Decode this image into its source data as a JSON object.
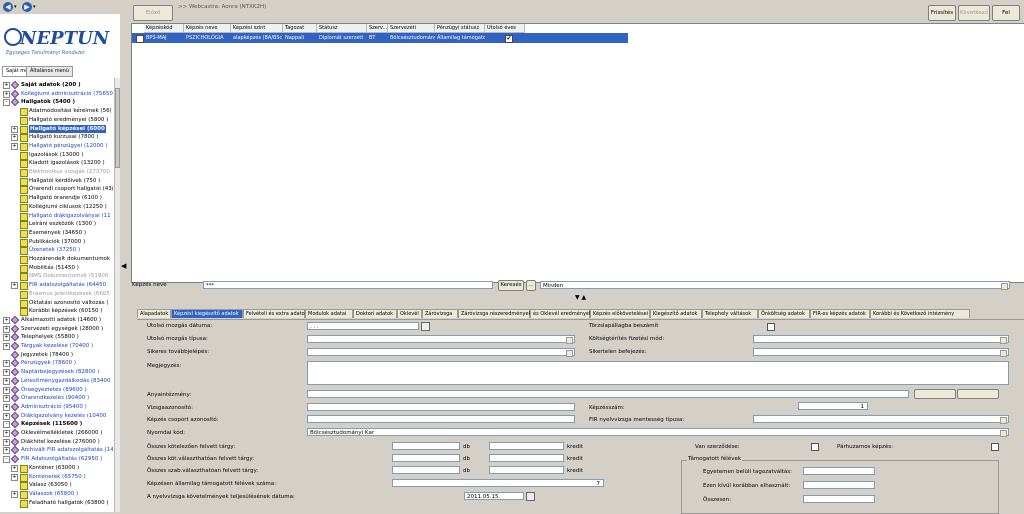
{
  "app": {
    "brand": "NEPTUN",
    "subtitle": "Egységes Tanulmányi Rendszer"
  },
  "left_tabs": [
    "Saját menü",
    "Általános menü"
  ],
  "tree": [
    {
      "label": "Saját adatok (200 )",
      "level": 0,
      "bold": true,
      "exp": "+"
    },
    {
      "label": "Kollégiumi adminisztráció (75650",
      "level": 0,
      "blue": true,
      "exp": "+"
    },
    {
      "label": "Hallgatók (5400 )",
      "level": 0,
      "bold": true,
      "exp": "-"
    },
    {
      "label": "Adatmódosítási kérelmek (56(",
      "level": 1
    },
    {
      "label": "Hallgató eredményei (5800 )",
      "level": 1
    },
    {
      "label": "Hallgató képzései (6000",
      "level": 1,
      "selected": true,
      "exp": "+"
    },
    {
      "label": "Hallgató kurzusai (7800 )",
      "level": 1,
      "exp": "+"
    },
    {
      "label": "Hallgató pénzügyei (12000 )",
      "level": 1,
      "blue": true,
      "exp": "+"
    },
    {
      "label": "Igazolások (13000 )",
      "level": 1
    },
    {
      "label": "Kiadott igazolások (13200 )",
      "level": 1
    },
    {
      "label": "Elektronikus vizsgák (273700",
      "level": 1,
      "gray": true
    },
    {
      "label": "Hallgatói kérdőívek (750 )",
      "level": 1
    },
    {
      "label": "Órarendi csoport hallgatói (43(",
      "level": 1
    },
    {
      "label": "Hallgató órarendje (6100 )",
      "level": 1
    },
    {
      "label": "Kollégiumi ciklusok (12250 )",
      "level": 1
    },
    {
      "label": "Hallgató diákigazolványai (11",
      "level": 1,
      "blue": true
    },
    {
      "label": "Leíráni eszközök (1300 )",
      "level": 1
    },
    {
      "label": "Események (34650 )",
      "level": 1
    },
    {
      "label": "Publikációk (37000 )",
      "level": 1
    },
    {
      "label": "Üzenetek (37250 )",
      "level": 1,
      "blue": true
    },
    {
      "label": "Hozzárendelt dokumentumok",
      "level": 1
    },
    {
      "label": "Mobilitás (51450 )",
      "level": 1
    },
    {
      "label": "NMS Dokumentumok (51900",
      "level": 1,
      "gray": true
    },
    {
      "label": "FIR adatszolgáltatás (64450",
      "level": 1,
      "blue": true,
      "exp": "+"
    },
    {
      "label": "Érasmus jelentkezések (6605",
      "level": 1,
      "gray": true
    },
    {
      "label": "Oktatási azonosító változás (",
      "level": 1
    },
    {
      "label": "Korábbi képzések (60150 )",
      "level": 1
    },
    {
      "label": "Alkalmazotti adatok (14600 )",
      "level": 0,
      "exp": "+"
    },
    {
      "label": "Szervezeti egységek (28000 )",
      "level": 0,
      "exp": "+"
    },
    {
      "label": "Telephelyek (55800 )",
      "level": 0,
      "exp": "+"
    },
    {
      "label": "Tárgyak kezelése (70400 )",
      "level": 0,
      "blue": true,
      "exp": "+"
    },
    {
      "label": "Jegyzetek (78400 )",
      "level": 0
    },
    {
      "label": "Pénzügyek (78600 )",
      "level": 0,
      "blue": true,
      "exp": "+"
    },
    {
      "label": "Naptárbejegyzések (82800 )",
      "level": 0,
      "blue": true,
      "exp": "+"
    },
    {
      "label": "Létesítménygazdálkodás (83400",
      "level": 0,
      "blue": true,
      "exp": "+"
    },
    {
      "label": "Óraegyeztetés (89600 )",
      "level": 0,
      "blue": true,
      "exp": "+"
    },
    {
      "label": "Órarendkezelés (90400 )",
      "level": 0,
      "blue": true,
      "exp": "+"
    },
    {
      "label": "Adminisztráció (95400 )",
      "level": 0,
      "blue": true,
      "exp": "+"
    },
    {
      "label": "Diákigazolvány kezelés (10400",
      "level": 0,
      "blue": true,
      "exp": "+"
    },
    {
      "label": "Képzések (115600 )",
      "level": 0,
      "bold": true,
      "exp": "-"
    },
    {
      "label": "Oklevélmellékletek (266000 )",
      "level": 0,
      "exp": "+"
    },
    {
      "label": "Diákhitel kezelése (276000 )",
      "level": 0,
      "exp": "+"
    },
    {
      "label": "Archivált FIR adatszolgáltatás (14",
      "level": 0,
      "blue": true,
      "exp": "+"
    },
    {
      "label": "FIR Adatszolgáltatás (62950 )",
      "level": 0,
      "blue": true,
      "exp": "-"
    },
    {
      "label": "Konténer (63000 )",
      "level": 1,
      "exp": "+"
    },
    {
      "label": "Konténerek (65750 )",
      "level": 1,
      "blue": true,
      "exp": "+"
    },
    {
      "label": "Válasz (63050 )",
      "level": 1
    },
    {
      "label": "Válaszok (65800 )",
      "level": 1,
      "blue": true,
      "exp": "+"
    },
    {
      "label": "Feladható hallgatók (63800 )",
      "level": 1
    }
  ],
  "toolbar": {
    "back": "Előző",
    "breadcrumb": ">> Webcastra: Aonra (NTXK2H)",
    "refresh": "Frissítés",
    "next": "Következő",
    "up": "Fel"
  },
  "grid": {
    "columns": [
      "Képzéskód",
      "Képzés neve",
      "Képzési szint",
      "Tagozat",
      "Státusz",
      "Szerv...",
      "Szervezeti egysé...",
      "Pénzügyi státusz",
      "Utolsó éves"
    ],
    "rows": [
      [
        "BPS-MAJ",
        "PSZICHOLÓGIA",
        "alapképzés (BA/BSc)",
        "Nappali",
        "Diplomát szerzett",
        "BT",
        "Bölcsésztudományi ...",
        "Államilag támogatott",
        "✔"
      ]
    ]
  },
  "search": {
    "label": "Képzés neve",
    "value": "***",
    "button": "Keresés",
    "filter": "Minden"
  },
  "tabs": [
    "Alapadatok",
    "Képzési kiegészítő adatok",
    "Felvételi és extra adatok",
    "Modulok adatai",
    "Doktori adatok",
    "Oklevél",
    "Záróvizsga",
    "Záróvizsga részeredmények",
    "és Oklevél eredmények",
    "Képzés előkövetelései",
    "Kiegészítő adatok",
    "Telephely váltások",
    "Önköltség adatok",
    "FIR-es képzés adatok",
    "Korábbi és Következő intézmény"
  ],
  "form": {
    "utolso_mozgas_datuma": "Utolsó mozgás dátuma:",
    "date_placeholder": ". . .",
    "torzslapallagba": "Törzslapállagba beszámít",
    "utolso_mozgas_tipusa": "Utolsó mozgás típusa:",
    "koltsegterites": "Költségtérítés fizetési mód:",
    "sikeres_tovabb": "Sikeres továbbjelépés:",
    "sikertelen_befejezes": "Sikertelen befejezés:",
    "megjegyzes": "Megjegyzés:",
    "anyainterlemeny": "Anyaintézmény:",
    "vizsgaazonosito": "Vizsgaazonosító:",
    "kepzesszam": "Képzésszám:",
    "kepzesszam_value": "1",
    "kepzes_csoport": "Képzés csoport azonosító:",
    "fir_nyelvvizsga": "FIR nyelvvizsga mentesség típusa:",
    "nyomdai_kod": "Nyomdai kód:",
    "nyomdai_value": "Bölcsésztudományi Kar",
    "osszes_kotelezo": "Összes kötelezően felvett tárgy:",
    "osszes_kotval": "Összes köt.választhatóan felvett tárgy:",
    "osszes_szab": "Összes szab.választhatóan felvett tárgy:",
    "db": "db",
    "kredit": "kredit",
    "allamilag": "Képzésen államilag támogatott félévek száma:",
    "allamilag_value": "7",
    "nyelvvizsga_datum": "A nyelvvizsga követelmények teljesülésének dátuma:",
    "nyelvvizsga_value": "2011.05.15.",
    "van_szerzodese": "Van szerződése:",
    "parhuzamos": "Párhuzamos képzés:",
    "tamogatott_felevek": "Támogatott félévek",
    "egyetemen_belul": "Egyetemen belüli tagozatváltás:",
    "ezen_kivul": "Ezen kívül korábban elhasznált:",
    "osszesen": "Összesen:"
  }
}
